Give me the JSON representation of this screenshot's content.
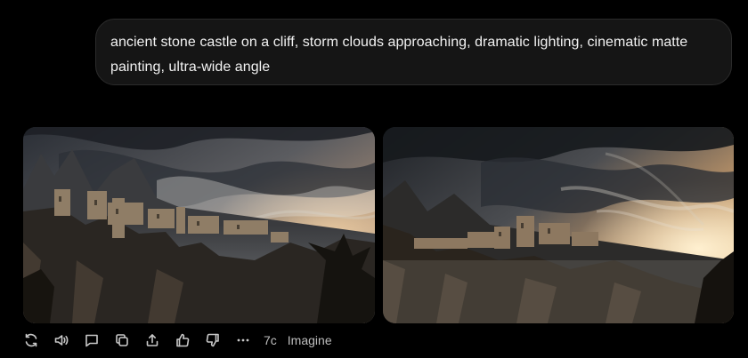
{
  "prompt": {
    "text": "ancient stone castle on a cliff, storm clouds approaching, dramatic lighting, cinematic matte painting, ultra-wide angle"
  },
  "images": [
    {
      "icon": "generated-image-castle-cliff-storm-1"
    },
    {
      "icon": "generated-image-castle-cliff-storm-2"
    }
  ],
  "toolbar": {
    "icons": [
      "regenerate-icon",
      "read-aloud-icon",
      "comment-icon",
      "copy-icon",
      "share-icon",
      "thumbs-up-icon",
      "thumbs-down-icon",
      "more-icon"
    ],
    "model_label": "7c",
    "imagine_label": "Imagine"
  },
  "colors": {
    "background": "#000000",
    "bubble": "#151515",
    "icon": "#c8c8c8"
  }
}
